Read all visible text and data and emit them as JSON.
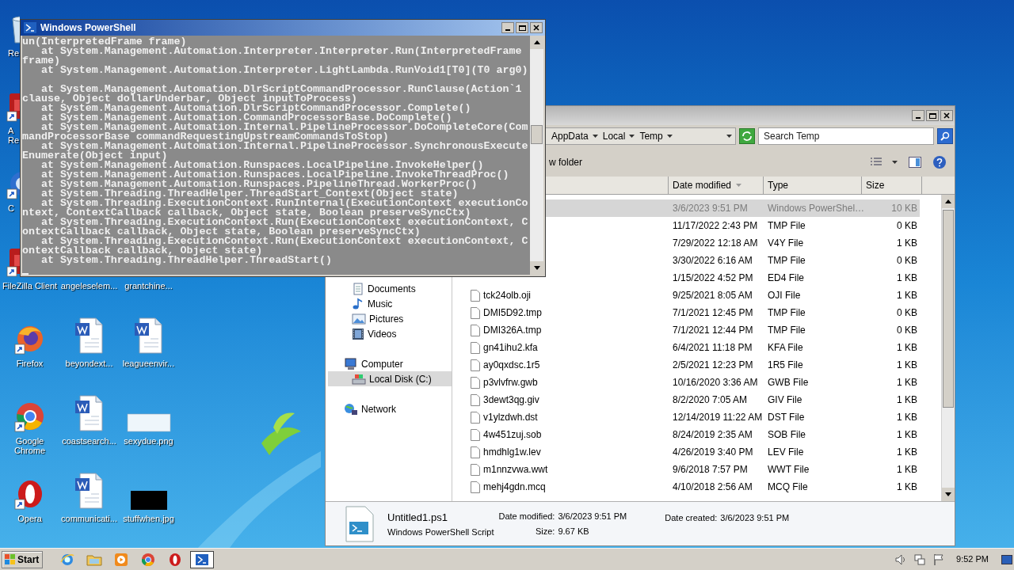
{
  "desktop": {
    "icons": [
      {
        "kind": "recycle",
        "cut": true,
        "lines": [
          "Re"
        ]
      },
      {
        "kind": "red-app",
        "cut": true,
        "lines": [
          "A",
          "Re"
        ]
      },
      {
        "kind": "cleaner",
        "cut": true,
        "lines": [
          "C"
        ]
      },
      {
        "kind": "red-app",
        "cut": true,
        "lines": [
          "FileZilla Client"
        ]
      },
      {
        "kind": "firefox",
        "lines": [
          "Firefox"
        ]
      },
      {
        "kind": "chrome",
        "lines": [
          "Google",
          "Chrome"
        ]
      },
      {
        "kind": "opera",
        "lines": [
          "Opera"
        ]
      },
      {
        "kind": "covered"
      },
      {
        "kind": "covered"
      },
      {
        "kind": "covered"
      },
      {
        "kind": "label-only",
        "lines": [
          "angeleselem..."
        ]
      },
      {
        "kind": "word",
        "lines": [
          "beyondext..."
        ]
      },
      {
        "kind": "word",
        "lines": [
          "coastsearch..."
        ]
      },
      {
        "kind": "word",
        "lines": [
          "communicati..."
        ]
      },
      {
        "kind": "covered"
      },
      {
        "kind": "covered"
      },
      {
        "kind": "covered"
      },
      {
        "kind": "label-only",
        "lines": [
          "grantchine..."
        ]
      },
      {
        "kind": "word",
        "lines": [
          "leagueenvir..."
        ]
      },
      {
        "kind": "image-light",
        "lines": [
          "sexydue.png"
        ]
      },
      {
        "kind": "image-dark",
        "lines": [
          "stuffwhen.jpg"
        ]
      }
    ]
  },
  "powershell": {
    "title": "Windows PowerShell",
    "lines": [
      {
        "kind": "text",
        "text": "un(InterpretedFrame frame)"
      },
      {
        "kind": "text",
        "text": "   at System.Management.Automation.Interpreter.Interpreter.Run(InterpretedFrame"
      },
      {
        "kind": "text",
        "text": "frame)"
      },
      {
        "kind": "text",
        "text": "   at System.Management.Automation.Interpreter.LightLambda.RunVoid1[T0](T0 arg0)"
      },
      {
        "kind": "blank"
      },
      {
        "kind": "text",
        "text": "   at System.Management.Automation.DlrScriptCommandProcessor.RunClause(Action`1"
      },
      {
        "kind": "text",
        "text": "clause, Object dollarUnderbar, Object inputToProcess)"
      },
      {
        "kind": "text",
        "text": "   at System.Management.Automation.DlrScriptCommandProcessor.Complete()"
      },
      {
        "kind": "text",
        "text": "   at System.Management.Automation.CommandProcessorBase.DoComplete()"
      },
      {
        "kind": "text",
        "text": "   at System.Management.Automation.Internal.PipelineProcessor.DoCompleteCore(Com"
      },
      {
        "kind": "text",
        "text": "mandProcessorBase commandRequestingUpstreamCommandsToStop)"
      },
      {
        "kind": "text",
        "text": "   at System.Management.Automation.Internal.PipelineProcessor.SynchronousExecute"
      },
      {
        "kind": "text",
        "text": "Enumerate(Object input)"
      },
      {
        "kind": "text",
        "text": "   at System.Management.Automation.Runspaces.LocalPipeline.InvokeHelper()"
      },
      {
        "kind": "text",
        "text": "   at System.Management.Automation.Runspaces.LocalPipeline.InvokeThreadProc()"
      },
      {
        "kind": "text",
        "text": "   at System.Management.Automation.Runspaces.PipelineThread.WorkerProc()"
      },
      {
        "kind": "text",
        "text": "   at System.Threading.ThreadHelper.ThreadStart_Context(Object state)"
      },
      {
        "kind": "text",
        "text": "   at System.Threading.ExecutionContext.RunInternal(ExecutionContext executionCo"
      },
      {
        "kind": "text",
        "text": "ntext, ContextCallback callback, Object state, Boolean preserveSyncCtx)"
      },
      {
        "kind": "text",
        "text": "   at System.Threading.ExecutionContext.Run(ExecutionContext executionContext, C"
      },
      {
        "kind": "text",
        "text": "ontextCallback callback, Object state, Boolean preserveSyncCtx)"
      },
      {
        "kind": "text",
        "text": "   at System.Threading.ExecutionContext.Run(ExecutionContext executionContext, C"
      },
      {
        "kind": "text",
        "text": "ontextCallback callback, Object state)"
      },
      {
        "kind": "text",
        "text": "   at System.Threading.ThreadHelper.ThreadStart()"
      },
      {
        "kind": "cursor"
      }
    ]
  },
  "explorer": {
    "breadcrumb": [
      "AppData",
      "Local",
      "Temp"
    ],
    "search": {
      "placeholder": "Search Temp"
    },
    "toolbar": {
      "new_folder": "w folder"
    },
    "columns": [
      {
        "label": "Date modified",
        "sorted": true
      },
      {
        "label": "Type",
        "sorted": false
      },
      {
        "label": "Size",
        "sorted": false
      }
    ],
    "nav": [
      {
        "children": [
          {
            "label": "Documents",
            "kind": "documents",
            "selected": false
          },
          {
            "label": "Music",
            "kind": "music",
            "selected": false
          },
          {
            "label": "Pictures",
            "kind": "pictures",
            "selected": false
          },
          {
            "label": "Videos",
            "kind": "videos",
            "selected": false
          }
        ]
      },
      {
        "label": "Computer",
        "kind": "computer",
        "selected": false,
        "children": [
          {
            "label": "Local Disk (C:)",
            "kind": "disk",
            "selected": true
          }
        ]
      },
      {
        "label": "Network",
        "kind": "network",
        "selected": false
      }
    ],
    "rows": [
      {
        "date": "3/6/2023 9:51 PM",
        "type": "Windows PowerShel…",
        "size": "10 KB",
        "selected": true
      },
      {
        "date": "11/17/2022 2:43 PM",
        "type": "TMP File",
        "size": "0 KB",
        "selected": false
      },
      {
        "date": "7/29/2022 12:18 AM",
        "type": "V4Y File",
        "size": "1 KB",
        "selected": false
      },
      {
        "date": "3/30/2022 6:16 AM",
        "type": "TMP File",
        "size": "0 KB",
        "selected": false
      },
      {
        "date": "1/15/2022 4:52 PM",
        "type": "ED4 File",
        "size": "1 KB",
        "selected": false
      },
      {
        "name": "tck24olb.oji",
        "date": "9/25/2021 8:05 AM",
        "type": "OJI File",
        "size": "1 KB",
        "selected": false
      },
      {
        "name": "DMI5D92.tmp",
        "date": "7/1/2021 12:45 PM",
        "type": "TMP File",
        "size": "0 KB",
        "selected": false
      },
      {
        "name": "DMI326A.tmp",
        "date": "7/1/2021 12:44 PM",
        "type": "TMP File",
        "size": "0 KB",
        "selected": false
      },
      {
        "name": "gn41ihu2.kfa",
        "date": "6/4/2021 11:18 PM",
        "type": "KFA File",
        "size": "1 KB",
        "selected": false
      },
      {
        "name": "ay0qxdsc.1r5",
        "date": "2/5/2021 12:23 PM",
        "type": "1R5 File",
        "size": "1 KB",
        "selected": false
      },
      {
        "name": "p3vlvfrw.gwb",
        "date": "10/16/2020 3:36 AM",
        "type": "GWB File",
        "size": "1 KB",
        "selected": false
      },
      {
        "name": "3dewt3qg.giv",
        "date": "8/2/2020 7:05 AM",
        "type": "GIV File",
        "size": "1 KB",
        "selected": false
      },
      {
        "name": "v1ylzdwh.dst",
        "date": "12/14/2019 11:22 AM",
        "type": "DST File",
        "size": "1 KB",
        "selected": false
      },
      {
        "name": "4w451zuj.sob",
        "date": "8/24/2019 2:35 AM",
        "type": "SOB File",
        "size": "1 KB",
        "selected": false
      },
      {
        "name": "hmdhlg1w.lev",
        "date": "4/26/2019 3:40 PM",
        "type": "LEV File",
        "size": "1 KB",
        "selected": false
      },
      {
        "name": "m1nnzvwa.wwt",
        "date": "9/6/2018 7:57 PM",
        "type": "WWT File",
        "size": "1 KB",
        "selected": false
      },
      {
        "name": "mehj4gdn.mcq",
        "date": "4/10/2018 2:56 AM",
        "type": "MCQ File",
        "size": "1 KB",
        "selected": false
      }
    ],
    "details": {
      "name": "Untitled1.ps1",
      "type": "Windows PowerShell Script",
      "fields": [
        {
          "label": "Date modified:",
          "value": "3/6/2023 9:51 PM"
        },
        {
          "label": "Size:",
          "value": "9.67 KB"
        },
        {
          "label": "Date created:",
          "value": "3/6/2023 9:51 PM"
        }
      ]
    }
  },
  "taskbar": {
    "start": "Start",
    "apps": [
      {
        "kind": "ie",
        "selected": false
      },
      {
        "kind": "folder",
        "selected": false
      },
      {
        "kind": "media",
        "selected": false
      },
      {
        "kind": "chrome",
        "selected": false
      },
      {
        "kind": "opera",
        "selected": false
      },
      {
        "kind": "powershell",
        "selected": true
      }
    ],
    "clock": "9:52 PM"
  }
}
